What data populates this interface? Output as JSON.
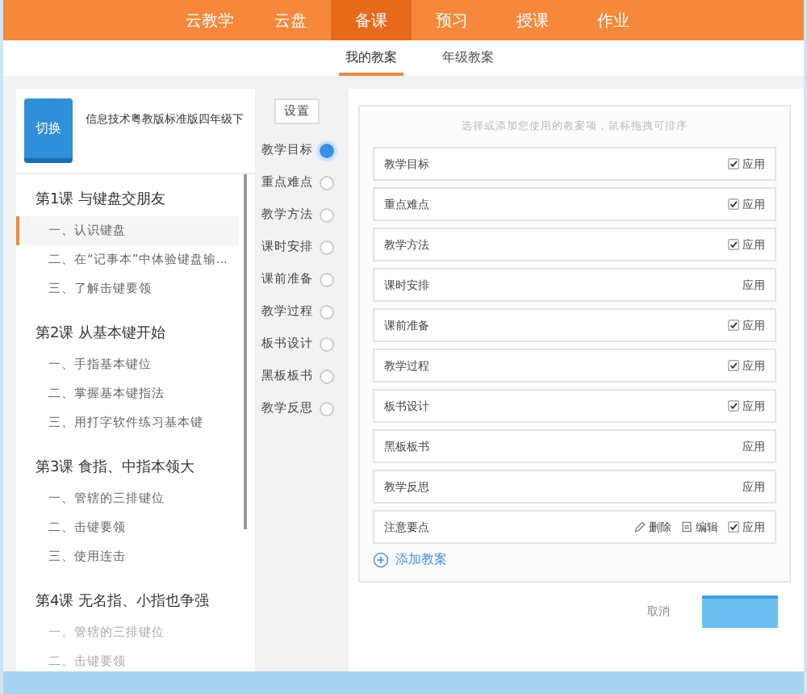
{
  "nav": [
    {
      "label": "云教学",
      "selected": false
    },
    {
      "label": "云盘",
      "selected": false
    },
    {
      "label": "备课",
      "selected": true
    },
    {
      "label": "预习",
      "selected": false
    },
    {
      "label": "授课",
      "selected": false
    },
    {
      "label": "作业",
      "selected": false
    }
  ],
  "subtabs": [
    {
      "label": "我的教案",
      "selected": true
    },
    {
      "label": "年级教案",
      "selected": false
    }
  ],
  "book": {
    "button": "切换",
    "title": "信息技术粤教版标准版四年级下"
  },
  "lessons": [
    {
      "title": "第1课 与键盘交朋友",
      "children": [
        {
          "label": "一、认识键盘",
          "selected": true
        },
        {
          "label": "二、在“记事本”中体验键盘输...",
          "selected": false
        },
        {
          "label": "三、了解击键要领",
          "selected": false
        }
      ]
    },
    {
      "title": "第2课 从基本键开始",
      "children": [
        {
          "label": "一、手指基本键位",
          "selected": false
        },
        {
          "label": "二、掌握基本键指法",
          "selected": false
        },
        {
          "label": "三、用打字软件练习基本键",
          "selected": false
        }
      ]
    },
    {
      "title": "第3课 食指、中指本领大",
      "children": [
        {
          "label": "一、管辖的三排键位",
          "selected": false
        },
        {
          "label": "二、击键要领",
          "selected": false
        },
        {
          "label": "三、使用连击",
          "selected": false
        }
      ]
    },
    {
      "title": "第4课 无名指、小指也争强",
      "children": [
        {
          "label": "一、管辖的三排键位",
          "selected": false
        },
        {
          "label": "二、击键要领",
          "selected": false
        }
      ]
    }
  ],
  "settings_button": "设置",
  "steps": [
    {
      "label": "教学目标",
      "selected": true
    },
    {
      "label": "重点难点",
      "selected": false
    },
    {
      "label": "教学方法",
      "selected": false
    },
    {
      "label": "课时安排",
      "selected": false
    },
    {
      "label": "课前准备",
      "selected": false
    },
    {
      "label": "教学过程",
      "selected": false
    },
    {
      "label": "板书设计",
      "selected": false
    },
    {
      "label": "黑板板书",
      "selected": false
    },
    {
      "label": "教学反思",
      "selected": false
    }
  ],
  "hint": "选择或添加您使用的教案项，鼠标拖拽可排序",
  "items": [
    {
      "name": "教学目标",
      "checked": true,
      "apply": "应用"
    },
    {
      "name": "重点难点",
      "checked": true,
      "apply": "应用"
    },
    {
      "name": "教学方法",
      "checked": true,
      "apply": "应用"
    },
    {
      "name": "课时安排",
      "checked": false,
      "apply": "应用"
    },
    {
      "name": "课前准备",
      "checked": true,
      "apply": "应用"
    },
    {
      "name": "教学过程",
      "checked": true,
      "apply": "应用"
    },
    {
      "name": "板书设计",
      "checked": true,
      "apply": "应用"
    },
    {
      "name": "黑板板书",
      "checked": false,
      "apply": "应用"
    },
    {
      "name": "教学反思",
      "checked": false,
      "apply": "应用"
    },
    {
      "name": "注意要点",
      "checked": true,
      "apply": "应用",
      "delete": "删除",
      "edit": "编辑"
    }
  ],
  "add_button": "添加教案",
  "cancel_button": "取消"
}
